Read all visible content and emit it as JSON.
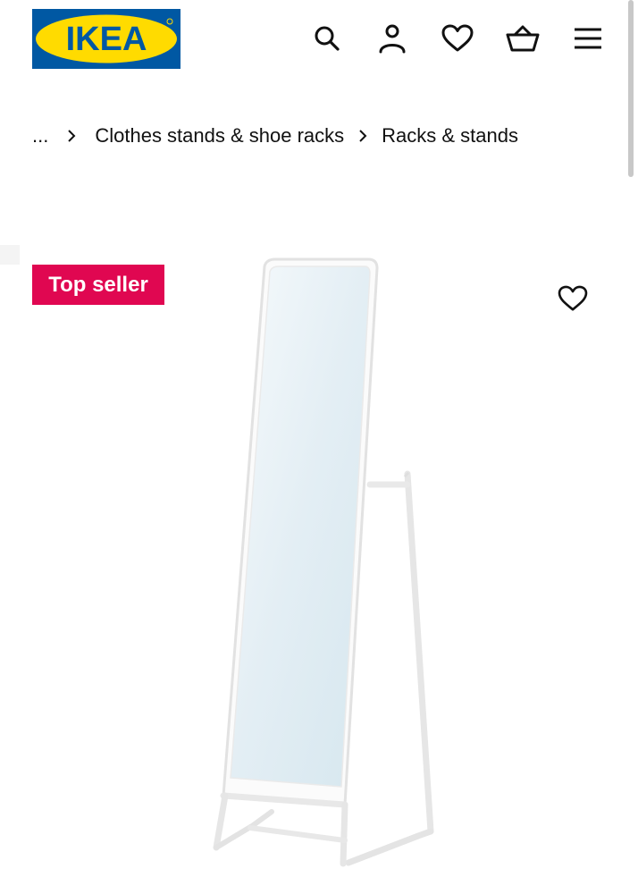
{
  "header": {
    "logo_text": "IKEA",
    "logo_colors": {
      "background": "#0058a3",
      "oval": "#ffdb00",
      "text": "#0058a3"
    },
    "icons": [
      "search-icon",
      "account-icon",
      "heart-icon",
      "cart-icon",
      "menu-icon"
    ]
  },
  "breadcrumb": {
    "ellipsis": "...",
    "items": [
      "Clothes stands & shoe racks",
      "Racks & stands"
    ],
    "separator_icon": "chevron-right-icon"
  },
  "product": {
    "badge": "Top seller",
    "badge_color": "#e00751",
    "favourite_icon": "heart-outline-icon",
    "image_icon": "standing-mirror-image"
  }
}
